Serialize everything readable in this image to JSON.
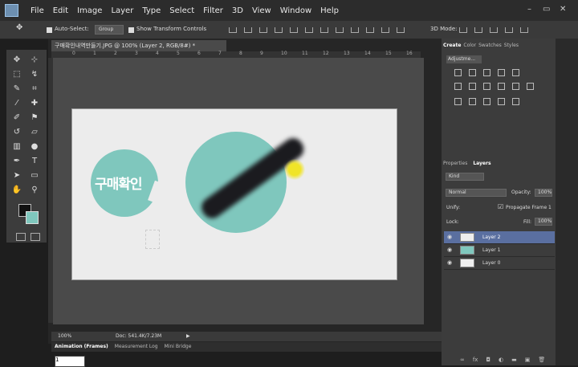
{
  "menubar": {
    "items": [
      "File",
      "Edit",
      "Image",
      "Layer",
      "Type",
      "Select",
      "Filter",
      "3D",
      "View",
      "Window",
      "Help"
    ],
    "mode_3d_label": "3D Mode:",
    "window_controls": [
      "–",
      "▭",
      "✕"
    ]
  },
  "options_bar": {
    "auto_select_label": "Auto-Select:",
    "auto_select_value": "Group",
    "show_transform_label": "Show Transform Controls"
  },
  "document": {
    "tab_title": "구매확인내역만들기.JPG @ 100% (Layer 2, RGB/8#) *",
    "ruler_ticks": [
      "0",
      "1",
      "2",
      "3",
      "4",
      "5",
      "6",
      "7",
      "8",
      "9",
      "10",
      "11",
      "12",
      "13",
      "14",
      "15",
      "16"
    ],
    "badge_text": "구매확인",
    "zoom": "100%",
    "doc_size": "Doc: 541.4K/7.23M"
  },
  "bottom_panel": {
    "tabs": [
      "Animation (Frames)",
      "Measurement Log",
      "Mini Bridge"
    ],
    "frame_value": "1"
  },
  "adjustments_panel": {
    "tabs": [
      "Create",
      "Color",
      "Swatches",
      "Styles"
    ],
    "select_value": "Adjustme..."
  },
  "layers_panel": {
    "tabs": [
      "Properties",
      "Layers"
    ],
    "kind_value": "Kind",
    "blend_mode": "Normal",
    "opacity_label": "Opacity:",
    "opacity_value": "100%",
    "unify_label": "Unify:",
    "propagate_label": "Propagate Frame 1",
    "lock_label": "Lock:",
    "fill_label": "Fill:",
    "fill_value": "100%",
    "layers": [
      {
        "name": "Layer 2",
        "selected": true
      },
      {
        "name": "Layer 1",
        "selected": false
      },
      {
        "name": "Layer 0",
        "selected": false
      }
    ],
    "footer_icons": [
      "link-icon",
      "fx-icon",
      "mask-icon",
      "adjustment-icon",
      "folder-icon",
      "new-layer-icon",
      "trash-icon"
    ]
  },
  "colors": {
    "accent": "#7fc7bd",
    "selected_layer": "#5a6fa0"
  }
}
